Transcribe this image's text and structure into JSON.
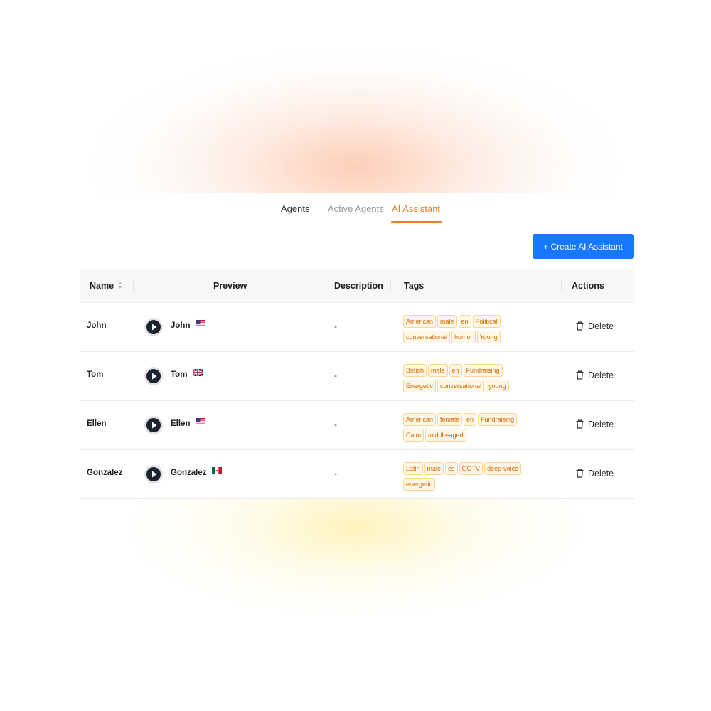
{
  "tabs": [
    {
      "label": "Agents"
    },
    {
      "label": "Active Agents"
    },
    {
      "label": "AI Assistant",
      "active": true
    }
  ],
  "create_button": {
    "label": "+ Create AI Assistant"
  },
  "colors": {
    "accent": "#f47a28",
    "primary": "#1677ff",
    "tag_text": "#d46b08",
    "tag_bg": "#fff7e6",
    "tag_border": "#ffd591"
  },
  "table": {
    "columns": {
      "name": "Name",
      "preview": "Preview",
      "description": "Description",
      "tags": "Tags",
      "actions": "Actions"
    },
    "sort_icon": "sort-icon",
    "rows": [
      {
        "name": "John",
        "preview_name": "John",
        "flag": "us-flag-icon",
        "description": "-",
        "tag_lines": [
          [
            "American",
            "male",
            "en",
            "Political"
          ],
          [
            "conversational",
            "humor",
            "Young"
          ]
        ],
        "action": "Delete"
      },
      {
        "name": "Tom",
        "preview_name": "Tom",
        "flag": "uk-flag-icon",
        "description": "-",
        "tag_lines": [
          [
            "British",
            "male",
            "en",
            "Fundraising"
          ],
          [
            "Energetic",
            "conversational",
            "young"
          ]
        ],
        "action": "Delete"
      },
      {
        "name": "Ellen",
        "preview_name": "Ellen",
        "flag": "us-flag-icon",
        "description": "-",
        "tag_lines": [
          [
            "American",
            "female",
            "en",
            "Fundraising"
          ],
          [
            "Calm",
            "middle-aged"
          ]
        ],
        "action": "Delete"
      },
      {
        "name": "Gonzalez",
        "preview_name": "Gonzalez",
        "flag": "mexico-flag-icon",
        "description": "-",
        "tag_lines": [
          [
            "Latin",
            "male",
            "es",
            "GOTV",
            "deep-voice"
          ],
          [
            "energetic"
          ]
        ],
        "action": "Delete"
      }
    ]
  }
}
